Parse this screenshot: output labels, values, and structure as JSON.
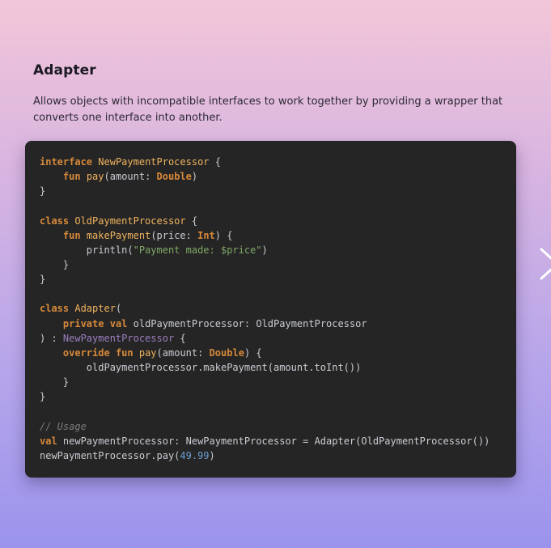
{
  "pattern": {
    "title": "Adapter",
    "description": "Allows objects with incompatible interfaces to work together by providing a wrapper that converts one interface into another."
  },
  "code": {
    "language": "kotlin",
    "lines": [
      [
        {
          "t": "interface",
          "c": "kw"
        },
        {
          "t": " ",
          "c": "pl"
        },
        {
          "t": "NewPaymentProcessor",
          "c": "fn"
        },
        {
          "t": " {",
          "c": "pl"
        }
      ],
      [
        {
          "t": "    ",
          "c": "pl"
        },
        {
          "t": "fun",
          "c": "kw"
        },
        {
          "t": " ",
          "c": "pl"
        },
        {
          "t": "pay",
          "c": "fn"
        },
        {
          "t": "(amount: ",
          "c": "pl"
        },
        {
          "t": "Double",
          "c": "kw"
        },
        {
          "t": ")",
          "c": "pl"
        }
      ],
      [
        {
          "t": "}",
          "c": "pl"
        }
      ],
      [],
      [
        {
          "t": "class",
          "c": "kw"
        },
        {
          "t": " ",
          "c": "pl"
        },
        {
          "t": "OldPaymentProcessor",
          "c": "fn"
        },
        {
          "t": " {",
          "c": "pl"
        }
      ],
      [
        {
          "t": "    ",
          "c": "pl"
        },
        {
          "t": "fun",
          "c": "kw"
        },
        {
          "t": " ",
          "c": "pl"
        },
        {
          "t": "makePayment",
          "c": "fn"
        },
        {
          "t": "(price: ",
          "c": "pl"
        },
        {
          "t": "Int",
          "c": "kw"
        },
        {
          "t": ") {",
          "c": "pl"
        }
      ],
      [
        {
          "t": "        println(",
          "c": "pl"
        },
        {
          "t": "\"Payment made: $price\"",
          "c": "str"
        },
        {
          "t": ")",
          "c": "pl"
        }
      ],
      [
        {
          "t": "    }",
          "c": "pl"
        }
      ],
      [
        {
          "t": "}",
          "c": "pl"
        }
      ],
      [],
      [
        {
          "t": "class",
          "c": "kw"
        },
        {
          "t": " ",
          "c": "pl"
        },
        {
          "t": "Adapter",
          "c": "fn"
        },
        {
          "t": "(",
          "c": "pl"
        }
      ],
      [
        {
          "t": "    ",
          "c": "pl"
        },
        {
          "t": "private",
          "c": "kw"
        },
        {
          "t": " ",
          "c": "pl"
        },
        {
          "t": "val",
          "c": "kw"
        },
        {
          "t": " oldPaymentProcessor: OldPaymentProcessor",
          "c": "pl"
        }
      ],
      [
        {
          "t": ") : ",
          "c": "pl"
        },
        {
          "t": "NewPaymentProcessor",
          "c": "iface"
        },
        {
          "t": " {",
          "c": "pl"
        }
      ],
      [
        {
          "t": "    ",
          "c": "pl"
        },
        {
          "t": "override",
          "c": "kw"
        },
        {
          "t": " ",
          "c": "pl"
        },
        {
          "t": "fun",
          "c": "kw"
        },
        {
          "t": " ",
          "c": "pl"
        },
        {
          "t": "pay",
          "c": "fn"
        },
        {
          "t": "(amount: ",
          "c": "pl"
        },
        {
          "t": "Double",
          "c": "kw"
        },
        {
          "t": ") {",
          "c": "pl"
        }
      ],
      [
        {
          "t": "        oldPaymentProcessor.makePayment(amount.toInt())",
          "c": "pl"
        }
      ],
      [
        {
          "t": "    }",
          "c": "pl"
        }
      ],
      [
        {
          "t": "}",
          "c": "pl"
        }
      ],
      [],
      [
        {
          "t": "// Usage",
          "c": "cm"
        }
      ],
      [
        {
          "t": "val",
          "c": "kw"
        },
        {
          "t": " newPaymentProcessor: NewPaymentProcessor = Adapter(OldPaymentProcessor())",
          "c": "pl"
        }
      ],
      [
        {
          "t": "newPaymentProcessor.pay(",
          "c": "pl"
        },
        {
          "t": "49.99",
          "c": "num"
        },
        {
          "t": ")",
          "c": "pl"
        }
      ]
    ]
  },
  "navigation": {
    "next_icon": "chevron-right-icon"
  },
  "colors": {
    "keyword": "#d7893a",
    "function": "#f0b35f",
    "interface_ref": "#9a7dbf",
    "string": "#7fa866",
    "number": "#6b9fd1",
    "comment": "#7c7c7c",
    "plain": "#c9ccd3",
    "card_background": "#252525"
  }
}
